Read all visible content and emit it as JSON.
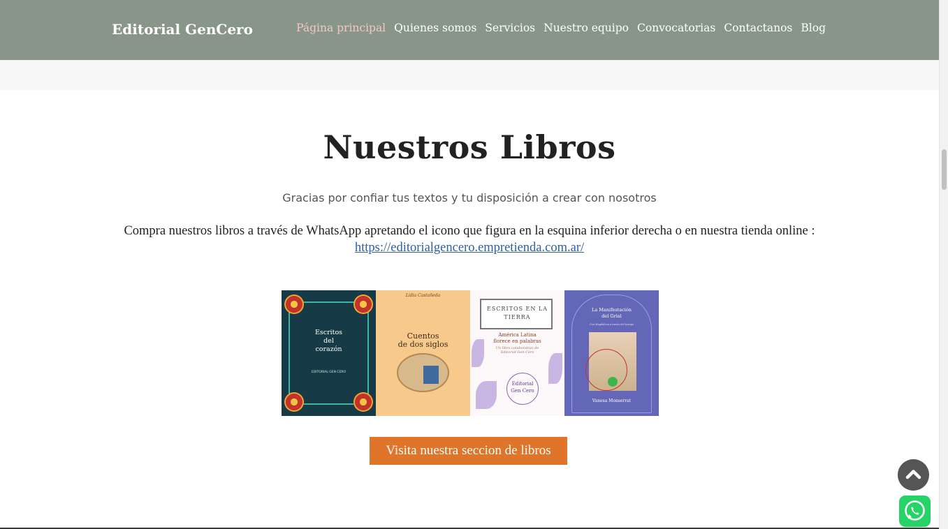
{
  "header": {
    "brand": "Editorial GenCero",
    "nav": [
      {
        "label": "Página principal",
        "active": true
      },
      {
        "label": "Quienes somos"
      },
      {
        "label": "Servicios"
      },
      {
        "label": "Nuestro equipo"
      },
      {
        "label": "Convocatorias"
      },
      {
        "label": "Contactanos"
      },
      {
        "label": "Blog"
      }
    ]
  },
  "main": {
    "title": "Nuestros Libros",
    "subtitle": "Gracias por confiar tus textos y tu disposición a crear con nosotros",
    "description": "Compra nuestros libros a través de WhatsApp apretando el icono que figura en la esquina inferior derecha o en nuestra tienda online :",
    "store_link": "https://editorialgencero.empretienda.com.ar/",
    "cta_label": "Visita nuestra seccion de libros"
  },
  "books": {
    "book1": {
      "title_line1": "Escritos",
      "title_line2": "del",
      "title_line3": "corazón",
      "publisher": "EDITORIAL GEN CERO"
    },
    "book2": {
      "author": "Lidia Castañeda",
      "title_line1": "Cuentos",
      "title_line2": "de dos siglos"
    },
    "book3": {
      "title_line1": "ESCRITOS EN LA",
      "title_line2": "TIERRA",
      "subtitle_line1": "América Latina",
      "subtitle_line2": "florece en palabras",
      "tagline_line1": "Un libro colaborativo de",
      "tagline_line2": "Editorial Gen Cero",
      "logo_line1": "Editorial",
      "logo_line2": "Gen Cero"
    },
    "book4": {
      "title_line1": "La Manifestación",
      "title_line2": "del Grial",
      "subtitle": "Con Magdalena a través del tiempo",
      "author": "Vanesa Monserrat"
    }
  },
  "colors": {
    "navbar": "#88968a",
    "nav_active": "#f4c6c2",
    "cta": "#e07428",
    "link": "#2f5ea8",
    "whatsapp": "#25d366"
  },
  "icons": {
    "scroll_top": "chevron-up-icon",
    "whatsapp": "whatsapp-icon"
  }
}
